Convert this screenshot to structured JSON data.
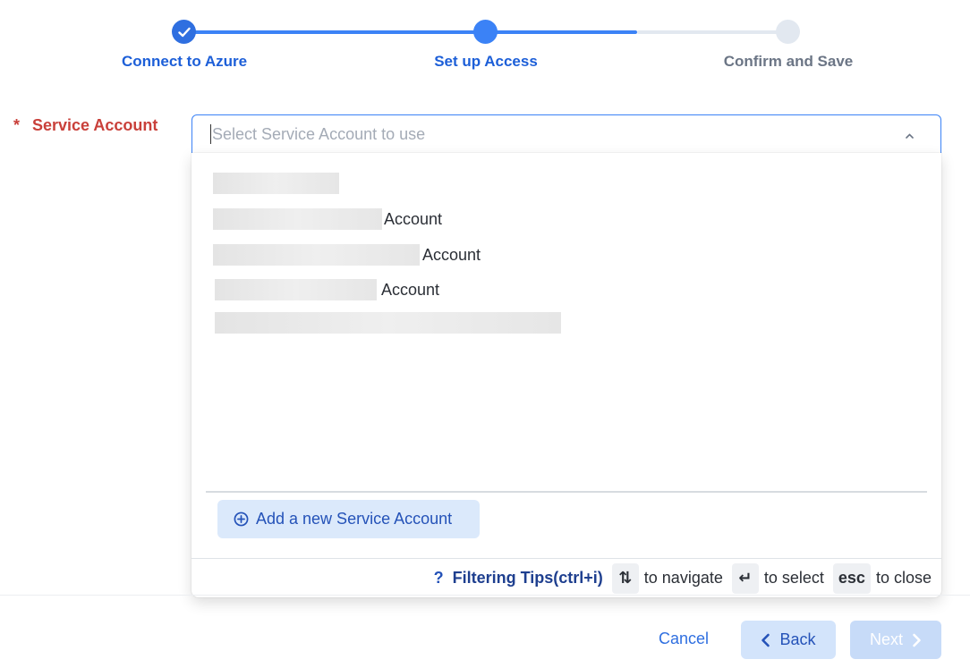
{
  "stepper": {
    "steps": [
      {
        "label": "Connect to Azure",
        "state": "complete"
      },
      {
        "label": "Set up Access",
        "state": "current"
      },
      {
        "label": "Confirm and Save",
        "state": "upcoming"
      }
    ],
    "progress_fraction": 0.75
  },
  "field": {
    "required_marker": "*",
    "label": "Service Account",
    "placeholder": "Select Service Account to use"
  },
  "dropdown": {
    "options": [
      {
        "suffix": ""
      },
      {
        "suffix": "Account"
      },
      {
        "suffix": "Account"
      },
      {
        "suffix": "Account"
      },
      {
        "suffix": ""
      }
    ],
    "add_button_label": "Add a new Service Account",
    "footer": {
      "help_mark": "?",
      "filtering_tips": "Filtering Tips(ctrl+i)",
      "navigate_key": "⇅",
      "navigate_text": "to navigate",
      "select_key": "↵",
      "select_text": "to select",
      "close_key": "esc",
      "close_text": "to close"
    }
  },
  "nav": {
    "cancel_label": "Cancel",
    "back_label": "Back",
    "next_label": "Next"
  },
  "colors": {
    "accent": "#3b82f6",
    "required_label": "#c9403a",
    "step_inactive": "#e2e8f0"
  }
}
